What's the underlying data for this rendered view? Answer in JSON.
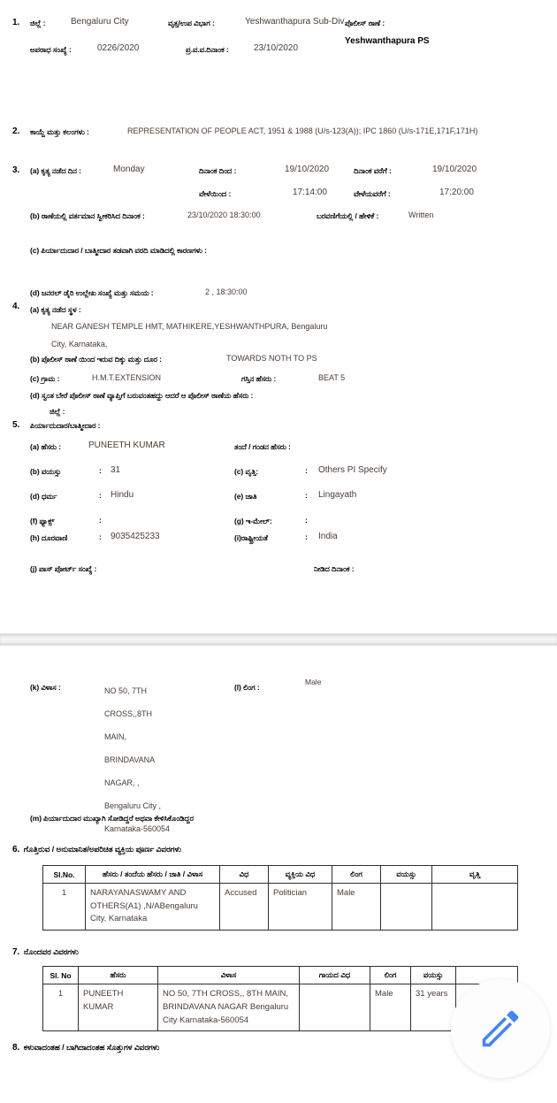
{
  "doc": {
    "type": "fir-report",
    "accent_blue": "#4285F4",
    "value_color": "#4a3b32"
  },
  "section1": {
    "number": "1.",
    "district_label": "ಜಿಲ್ಲೆ :",
    "district_value": "Bengaluru City",
    "subdiv_label": "ವೃತ್ತ/ಉಪ ವಿಭಾಗ :",
    "subdiv_value": "Yeshwanthapura Sub-Div",
    "ps_label": "ಪೊಲೀಸ್ ಠಾಣೆ :",
    "ps_value": "Yeshwanthapura PS",
    "crime_no_label": "ಅಪರಾಧ ಸಂಖ್ಯೆ :",
    "crime_no_value": "0226/2020",
    "fir_date_label": "ಪ್ರ.ವ.ವ.ದಿನಾಂಕ :",
    "fir_date_value": "23/10/2020"
  },
  "section2": {
    "number": "2.",
    "label": "ಕಾಯ್ದೆ ಮತ್ತು ಕಲಂಗಳು :",
    "value": "REPRESENTATION OF PEOPLE ACT, 1951 & 1988 (U/s-123(A)); IPC 1860 (U/s-171E,171F,171H)"
  },
  "section3": {
    "number": "3.",
    "a_label": "(a) ಕೃತ್ಯ ನಡೆದ ದಿನ :",
    "a_value": "Monday",
    "date_from_label": "ದಿನಾಂಕ ದಿಂದ :",
    "date_from_value": "19/10/2020",
    "date_to_label": "ದಿನಾಂಕ ವರೆಗೆ :",
    "date_to_value": "19/10/2020",
    "time_from_label": "ವೇಳೆಯಿಂದ   :",
    "time_from_value": "17:14:00",
    "time_to_label": "ವೇಳೆಯವರೆಗೆ  :",
    "time_to_value": "17:20:00",
    "b_label": "(b) ಠಾಣೆಯಲ್ಲಿ ವರ್ತಮಾನ ಸ್ವೀಕರಿಸಿದ ದಿನಾಂಕ :",
    "b_value": "23/10/2020 18:30:00",
    "b2_label": "ಬರವಣಿಗೆಯಲ್ಲಿ / ಹೇಳಿಕೆ :",
    "b2_value": "Written",
    "c_label": "(c) ಪಿರ್ಯಾದುದಾರ / ಬಾತ್ಮೀದಾರ ತಡವಾಗಿ ವರದಿ ಮಾಡಿದಲ್ಲಿ ಕಾರಣಗಳು :",
    "c_value": "",
    "d_label": "(d) ಜನರಲ್ ಡೈರಿ ಉಲ್ಲೇಖ ಸಂಖ್ಯೆ ಮತ್ತು ಸಮಯ :",
    "d_value": "2 , 18:30:00"
  },
  "section4": {
    "number": "4.",
    "a_label": "(a) ಕೃತ್ಯ ನಡೆದ ಸ್ಥಳ :",
    "a_value_line1": "NEAR GANESH TEMPLE HMT, MATHIKERE,YESHWANTHPURA, Bengaluru",
    "a_value_line2": "City, Karnataka,",
    "b_label": "(b) ಪೊಲೀಸ್ ಠಾಣೆ ಯಿಂದ ಇರುವ ದಿಕ್ಕು ಮತ್ತು ದೂರ :",
    "b_value": "TOWARDS NOTH TO PS",
    "c_label": "(c) ಗ್ರಾಮ :",
    "c_value": "H.M.T.EXTENSION",
    "c2_label": "ಗಸ್ತಿನ ಹೆಸರು :",
    "c2_value": "BEAT 5",
    "d_label": "(d) ಸ್ವಂತ ಬೇರೆ ಪೊಲೀಸ್ ಠಾಣೆ ವ್ಯಾಪ್ತಿಗೆ ಬರುವಂತಹದ್ದು ಆದರೆ ಆ ಪೊಲೀಸ್ ಠಾಣೆಯ ಹೆಸರು :",
    "d2_label": "ಜಿಲ್ಲೆ :",
    "d2_value": ""
  },
  "section5": {
    "number": "5.",
    "title": "ಪಿರ್ಯಾದುದಾರ/ಬಾತ್ಮೀದಾರ :",
    "a_label": "(a) ಹೆಸರು :",
    "a_value": "PUNEETH KUMAR",
    "father_label": "ತಂದೆ / ಗಂಡನ ಹೆಸರು :",
    "father_value": "",
    "b_label": "(b) ವಯಸ್ಸು",
    "b_value": "31",
    "c_label": "(c) ವೃತ್ತಿ:",
    "c_value": "Others PI Specify",
    "d_label": "(d) ಧರ್ಮ",
    "d_value": "Hindu",
    "e_label": "(e) ಜಾತಿ",
    "e_value": "Lingayath",
    "f_label": "(f) ಫ್ಯಾಕ್ಸ್",
    "f_value": "",
    "g_label": "(g) ಇ-ಮೇಲ್:",
    "g_value": "",
    "h_label": "(h) ದೂರವಾಣಿ",
    "h_value": "9035425233",
    "i_label": "(i)ರಾಷ್ಟ್ರೀಯತೆ",
    "i_value": "India",
    "j_label": "(j) ಪಾಸ್ ಪೋರ್ಟ್ ಸಂಖ್ಯೆ :",
    "j_value": "",
    "j2_label": "ನೀಡಿದ ದಿನಾಂಕ :",
    "j2_value": "",
    "k_label": "(k) ವಿಳಾಸ :",
    "k_value_lines": [
      "NO 50, 7TH",
      "CROSS,,8TH",
      "MAIN,",
      "BRINDAVANA",
      "NAGAR, ,",
      "Bengaluru City ,",
      "Karnataka-560054"
    ],
    "l_label": "(l) ಲಿಂಗ :",
    "l_value": "Male",
    "m_label": "(m) ಪಿರ್ಯಾದುದಾರ ಮುಖ್ಯಾಗಿ ಸೋಡಿದ್ದರೆ ಅಥವಾ ಕೇಳಿಸಿಕೊಂಡಿದ್ದರ"
  },
  "section6": {
    "number": "6.",
    "title": "ಗೊತ್ತಿರುವ / ಅನುಮಾನಿತ/ಅಪರಿಚಿತ ವ್ಯಕ್ತಿಯ ಪೂರ್ಣ ವಿವರಗಳು",
    "headers": [
      "Sl.No.",
      "ಹೆಸರು / ತಂದೆಯ ಹೆಸರು / ಜಾತಿ / ವಿಳಾಸ",
      "ವಿಧ",
      "ವ್ಯಕ್ತಿಯ ವಿಧ",
      "ಲಿಂಗ",
      "ವಯಸ್ಸು",
      "ವೃತ್ತಿ"
    ],
    "rows": [
      {
        "sl": "1",
        "name": "NARAYANASWAMY AND OTHERS(A1) ,N/ABengaluru City, Karnataka",
        "kind": "Accused",
        "person_type": "Politician",
        "gender": "Male",
        "age": "",
        "occupation": ""
      }
    ]
  },
  "section7": {
    "number": "7.",
    "title": "ನೊಂದವರ ವಿವರಗಳು",
    "headers": [
      "Sl. No",
      "ಹೆಸರು",
      "ವಿಳಾಸ",
      "ಗಾಯದ ವಿಧ",
      "ಲಿಂಗ",
      "ವಯಸ್ಸು",
      ""
    ],
    "rows": [
      {
        "sl": "1",
        "name": "PUNEETH KUMAR",
        "address": "NO 50, 7TH CROSS,, 8TH MAIN, BRINDAVANA NAGAR Bengaluru City Karnataka-560054",
        "injury": "",
        "gender": "Male",
        "age": "31 years",
        "extra": ""
      }
    ]
  },
  "section8": {
    "number": "8.",
    "title": "ಕಳುವಾದಂತಹ / ಬಾಗಿದಾದಂತಹ ಸೊತ್ತುಗಳ ವಿವರಗಳು"
  },
  "fab": {
    "icon": "pencil-edit-icon",
    "label": "Edit"
  }
}
